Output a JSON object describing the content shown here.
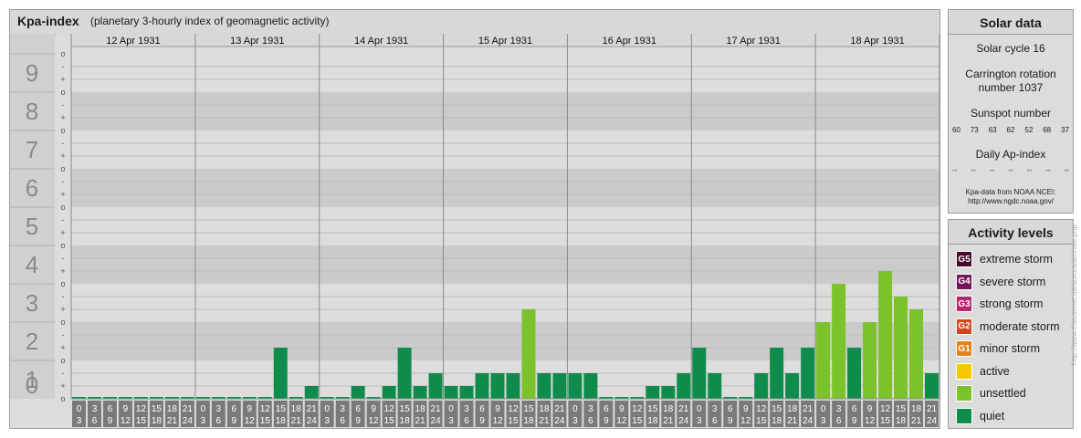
{
  "header": {
    "title": "Kpa-index",
    "subtitle": "(planetary 3-hourly index of geomagnetic activity)"
  },
  "chart_data": {
    "type": "bar",
    "ylim": [
      0,
      9
    ],
    "y_ticks": [
      "0",
      "1",
      "2",
      "3",
      "4",
      "5",
      "6",
      "7",
      "8",
      "9"
    ],
    "y_minor_ticks": [
      "o",
      "+",
      "-"
    ],
    "days": [
      "12 Apr 1931",
      "13 Apr 1931",
      "14 Apr 1931",
      "15 Apr 1931",
      "16 Apr 1931",
      "17 Apr 1931",
      "18 Apr 1931"
    ],
    "hour_labels_top": [
      "0",
      "3",
      "6",
      "9",
      "12",
      "15",
      "18",
      "21"
    ],
    "hour_labels_bottom": [
      "3",
      "6",
      "9",
      "12",
      "15",
      "18",
      "21",
      "24"
    ],
    "values": [
      0,
      0,
      0,
      0,
      0,
      0,
      0,
      0,
      0,
      0,
      0,
      0,
      0,
      1.333,
      0,
      0.333,
      0,
      0,
      0.333,
      0,
      0.333,
      1.333,
      0.333,
      0.667,
      0.333,
      0.333,
      0.667,
      0.667,
      0.667,
      2.333,
      0.667,
      0.667,
      0.667,
      0.667,
      0,
      0,
      0,
      0.333,
      0.333,
      0.667,
      1.333,
      0.667,
      0,
      0,
      0.667,
      1.333,
      0.667,
      1.333,
      2,
      3,
      1.333,
      2,
      3.333,
      2.667,
      2.333,
      0.667
    ],
    "colors": {
      "quiet": "#0f8c4c",
      "unsettled": "#7cc22a",
      "active": "#f5c800",
      "minor": "#e6821e",
      "moderate": "#d2461e",
      "strong": "#b4286e",
      "severe": "#78145a",
      "extreme": "#46082d"
    }
  },
  "solar": {
    "title": "Solar data",
    "cycle": "Solar cycle 16",
    "carrington": "Carrington rotation number 1037",
    "sunspot_title": "Sunspot number",
    "sunspot_values": [
      "60",
      "73",
      "63",
      "62",
      "52",
      "68",
      "37"
    ],
    "ap_title": "Daily Ap-index",
    "ap_values": [
      "--",
      "--",
      "--",
      "--",
      "--",
      "--",
      "--"
    ],
    "source_line1": "Kpa-data from NOAA NCEI:",
    "source_line2": "http://www.ngdc.noaa.gov/"
  },
  "levels": {
    "title": "Activity levels",
    "items": [
      {
        "badge": "G5",
        "label": "extreme storm",
        "color": "#46082d"
      },
      {
        "badge": "G4",
        "label": "severe storm",
        "color": "#78145a"
      },
      {
        "badge": "G3",
        "label": "strong storm",
        "color": "#b4286e"
      },
      {
        "badge": "G2",
        "label": "moderate storm",
        "color": "#d2461e"
      },
      {
        "badge": "G1",
        "label": "minor storm",
        "color": "#e6821e"
      },
      {
        "badge": "",
        "label": "active",
        "color": "#f5c800"
      },
      {
        "badge": "",
        "label": "unsettled",
        "color": "#7cc22a"
      },
      {
        "badge": "",
        "label": "quiet",
        "color": "#0f8c4c"
      }
    ]
  },
  "credit": "http://www.theusenet.de/aurora/archive.php"
}
